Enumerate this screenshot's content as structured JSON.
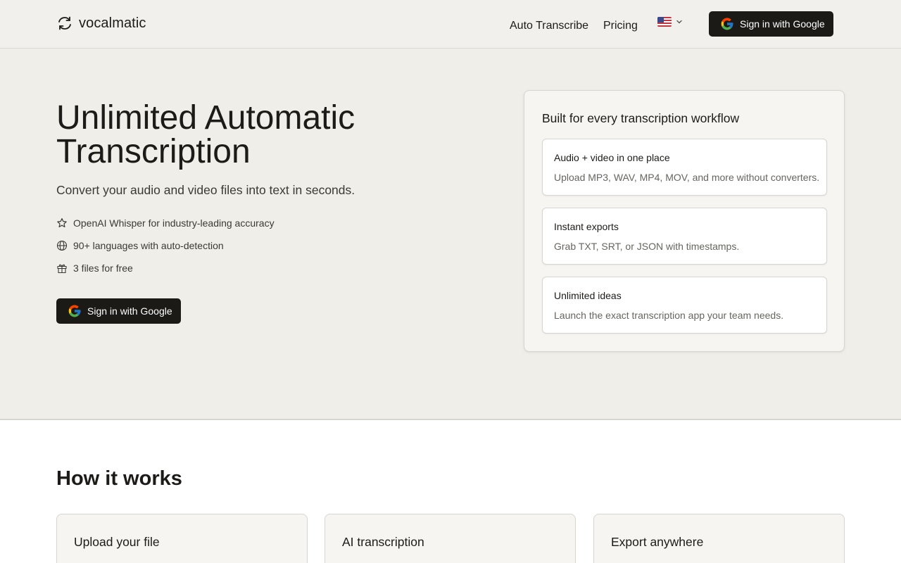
{
  "brand": {
    "name": "vocalmatic",
    "icon": "refresh-cycle-icon"
  },
  "nav": {
    "links": [
      "Auto Transcribe",
      "Pricing"
    ],
    "language": {
      "flag": "us-flag-icon"
    },
    "signin_label": "Sign in with Google"
  },
  "hero": {
    "title": "Unlimited Automatic Transcription",
    "subtitle": "Convert your audio and video files into text in seconds.",
    "features": [
      {
        "icon": "star-icon",
        "text": "OpenAI Whisper for industry-leading accuracy"
      },
      {
        "icon": "globe-icon",
        "text": "90+ languages with auto-detection"
      },
      {
        "icon": "gift-icon",
        "text": "3 files for free"
      }
    ],
    "cta_label": "Sign in with Google"
  },
  "workflow": {
    "title": "Built for every transcription workflow",
    "cards": [
      {
        "title": "Audio + video in one place",
        "desc": "Upload MP3, WAV, MP4, MOV, and more without converters."
      },
      {
        "title": "Instant exports",
        "desc": "Grab TXT, SRT, or JSON with timestamps."
      },
      {
        "title": "Unlimited ideas",
        "desc": "Launch the exact transcription app your team needs."
      }
    ]
  },
  "how": {
    "title": "How it works",
    "steps": [
      "Upload your file",
      "AI transcription",
      "Export anywhere"
    ]
  },
  "colors": {
    "header_bg": "#f1f0ec",
    "hero_bg": "#efeee8",
    "button_dark": "#1b1a17",
    "text_primary": "#1c1b18",
    "text_muted": "#66655f"
  }
}
